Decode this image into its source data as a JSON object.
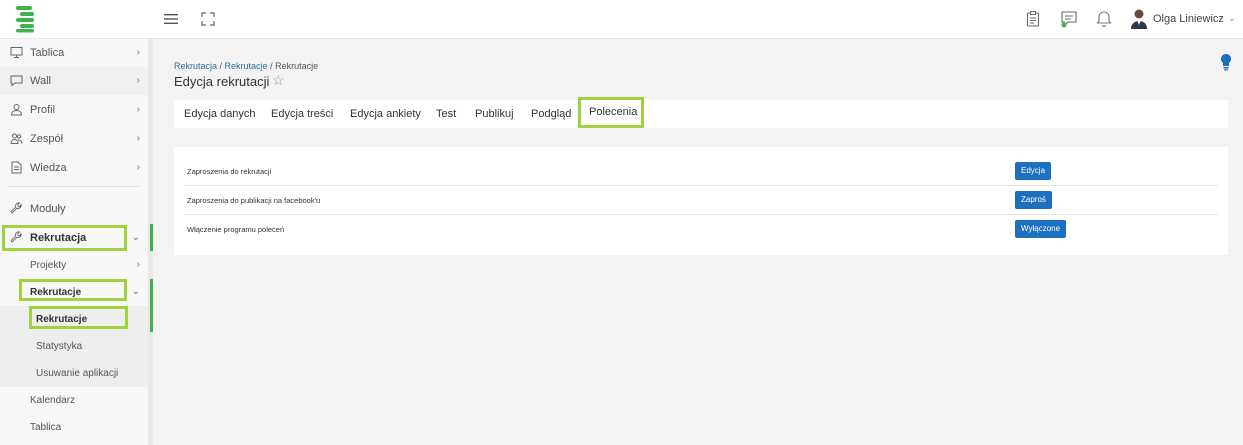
{
  "header": {
    "user_name": "Olga Liniewicz",
    "user_chevron": "⌄"
  },
  "sidebar": {
    "items": [
      {
        "label": "Tablica",
        "icon": "monitor-icon"
      },
      {
        "label": "Wall",
        "icon": "chat-icon"
      },
      {
        "label": "Profil",
        "icon": "user-icon"
      },
      {
        "label": "Zespół",
        "icon": "team-icon"
      },
      {
        "label": "Wiedza",
        "icon": "document-icon"
      },
      {
        "label": "Moduły",
        "icon": "wrench-icon"
      },
      {
        "label": "Rekrutacja",
        "icon": "wrench-icon"
      }
    ],
    "sub": {
      "projekty": "Projekty",
      "rekrutacje": "Rekrutacje",
      "rekrutacje_leaf": "Rekrutacje",
      "statystyka": "Statystyka",
      "usuwanie": "Usuwanie aplikacji",
      "kalendarz": "Kalendarz",
      "tablica": "Tablica"
    },
    "chev_right": "›",
    "chev_down": "⌄"
  },
  "main": {
    "breadcrumb": {
      "part1": "Rekrutacja",
      "sep": " / ",
      "part2": "Rekrutacje",
      "part3": "Rekrutacje"
    },
    "title": "Edycja rekrutacji",
    "star": "☆",
    "tabs": [
      "Edycja danych",
      "Edycja treści",
      "Edycja ankiety",
      "Test",
      "Publikuj",
      "Podgląd",
      "Polecenia"
    ],
    "rows": [
      {
        "text": "Zaproszenia do rekrutacji",
        "button": "Edycja"
      },
      {
        "text": "Zaproszenia do publikacji na facebook'u",
        "button": "Zaproś"
      },
      {
        "text": "Włączenie programu poleceń",
        "button": "Wyłączone"
      }
    ]
  },
  "colors": {
    "accent_green": "#9fd23c",
    "button_blue": "#1d6fc0",
    "link_blue": "#2f6ea6"
  }
}
